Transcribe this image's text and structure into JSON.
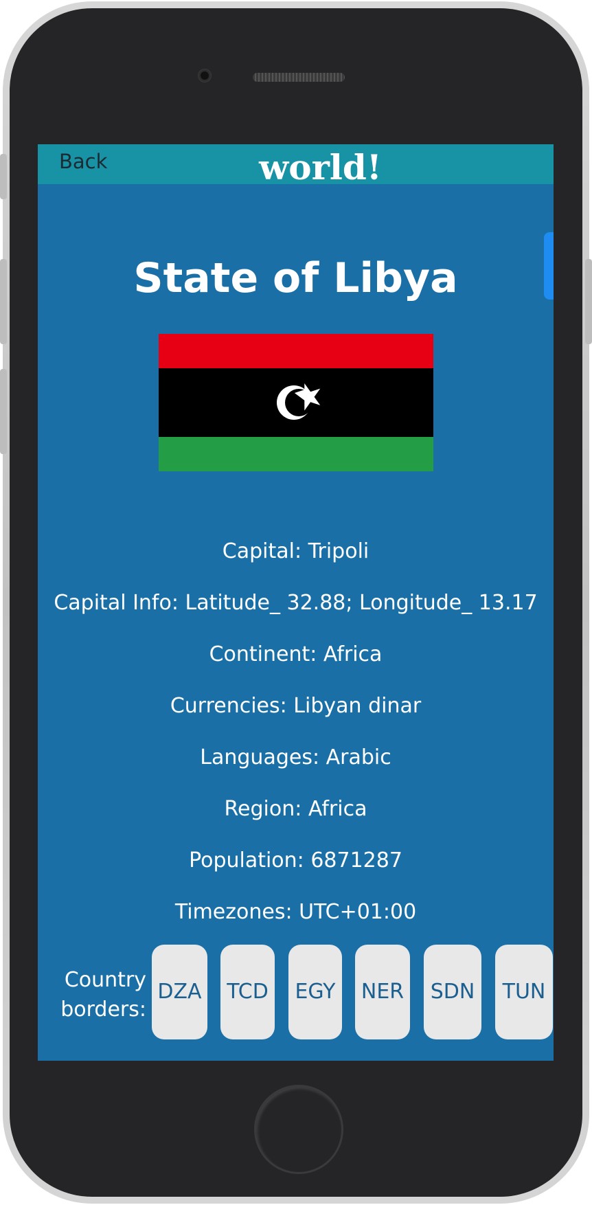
{
  "header": {
    "back_label": "Back",
    "app_title": "world!"
  },
  "country": {
    "title": "State of Libya",
    "flag_icon": "libya-flag",
    "flag_colors": {
      "top": "#e70013",
      "middle": "#000000",
      "bottom": "#239e46",
      "emblem": "#ffffff"
    },
    "info_lines": [
      "Capital: Tripoli",
      "Capital Info: Latitude_ 32.88; Longitude_ 13.17",
      "Continent: Africa",
      "Currencies: Libyan dinar",
      "Languages: Arabic",
      "Region: Africa",
      "Population: 6871287",
      "Timezones: UTC+01:00"
    ],
    "borders_label_line1": "Country",
    "borders_label_line2": "borders:",
    "borders": [
      "DZA",
      "TCD",
      "EGY",
      "NER",
      "SDN",
      "TUN"
    ]
  },
  "colors": {
    "screen_bg": "#1a70a6",
    "header_bg": "#1893a6",
    "button_bg": "#e8e8e8",
    "button_text": "#1a5f8f",
    "scroll_accent": "#1e8cf0"
  }
}
